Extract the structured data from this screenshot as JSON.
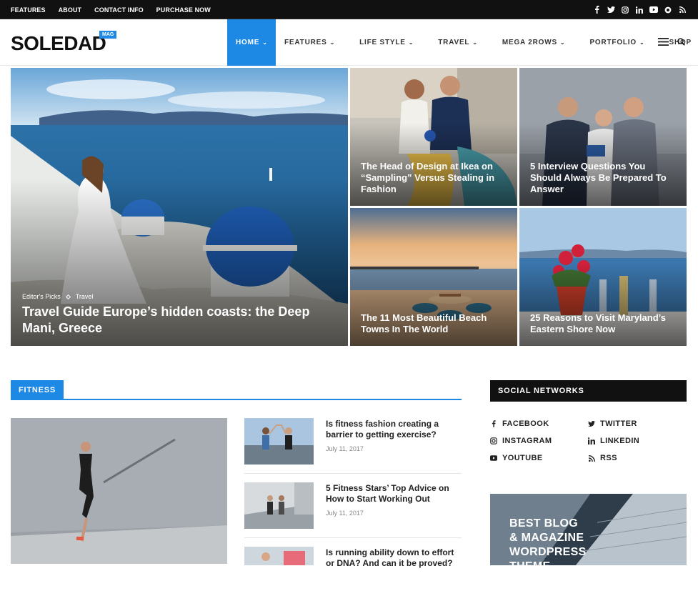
{
  "topbar": {
    "links": [
      "FEATURES",
      "ABOUT",
      "CONTACT INFO",
      "PURCHASE NOW"
    ],
    "social_icons": [
      "facebook-icon",
      "twitter-icon",
      "instagram-icon",
      "linkedin-icon",
      "youtube-icon",
      "snapchat-icon",
      "rss-icon"
    ]
  },
  "header": {
    "logo": "SOLEDAD",
    "logo_badge": "MAG",
    "nav": [
      "HOME",
      "FEATURES",
      "LIFE STYLE",
      "TRAVEL",
      "MEGA 2ROWS",
      "PORTFOLIO",
      "SHOP"
    ],
    "accent_color": "#1e88e5"
  },
  "featured": {
    "main": {
      "categories": [
        "Editor's Picks",
        "Travel"
      ],
      "title": "Travel Guide Europe’s hidden coasts: the Deep Mani, Greece"
    },
    "tiles": [
      {
        "title": "The Head of Design at Ikea on “Sampling” Versus Stealing in Fashion"
      },
      {
        "title": "5 Interview Questions You Should Always Be Prepared To Answer"
      },
      {
        "title": "The 11 Most Beautiful Beach Towns In The World"
      },
      {
        "title": "25 Reasons to Visit Maryland’s Eastern Shore Now"
      }
    ]
  },
  "fitness": {
    "heading": "FITNESS",
    "posts": [
      {
        "title": "Is fitness fashion creating a barrier to getting exercise?",
        "date": "July 11, 2017"
      },
      {
        "title": "5 Fitness Stars’ Top Advice on How to Start Working Out",
        "date": "July 11, 2017"
      },
      {
        "title": "Is running ability down to effort or DNA? And can it be proved?",
        "date": ""
      }
    ]
  },
  "sidebar": {
    "heading": "SOCIAL NETWORKS",
    "networks": [
      "FACEBOOK",
      "TWITTER",
      "INSTAGRAM",
      "LINKEDIN",
      "YOUTUBE",
      "RSS"
    ],
    "promo_text": "BEST BLOG\n& MAGAZINE\nWORDPRESS\nTHEME"
  }
}
